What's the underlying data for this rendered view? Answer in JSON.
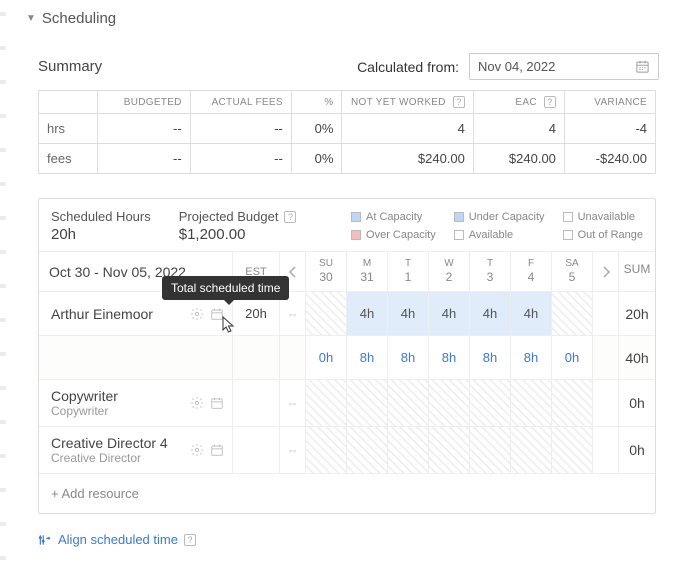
{
  "section_title": "Scheduling",
  "summary_label": "Summary",
  "calc_from_label": "Calculated from:",
  "calc_date": "Nov 04, 2022",
  "tooltip": "Total scheduled time",
  "summary_table": {
    "cols": [
      "BUDGETED",
      "ACTUAL FEES",
      "%",
      "NOT YET WORKED",
      "EAC",
      "VARIANCE"
    ],
    "rows": [
      {
        "label": "hrs",
        "cells": [
          "--",
          "--",
          "0%",
          "4",
          "4",
          "-4"
        ]
      },
      {
        "label": "fees",
        "cells": [
          "--",
          "--",
          "0%",
          "$240.00",
          "$240.00",
          "-$240.00"
        ]
      }
    ]
  },
  "metrics": {
    "sched_hours_label": "Scheduled Hours",
    "sched_hours_val": "20h",
    "proj_budget_label": "Projected Budget",
    "proj_budget_val": "$1,200.00"
  },
  "legend": {
    "atcap": "At Capacity",
    "under": "Under Capacity",
    "unavail": "Unavailable",
    "over": "Over Capacity",
    "avail": "Available",
    "outrange": "Out of Range"
  },
  "colors": {
    "atcap": "#bdd6f5",
    "under": "#bdd6f5",
    "over": "#f5bdbf",
    "avail": "#ffffff",
    "unavail": "#ffffff",
    "outrange": "#ffffff"
  },
  "range": {
    "label": "Oct 30 - Nov 05, 2022",
    "est": "EST",
    "days": [
      {
        "d": "SU",
        "n": "30"
      },
      {
        "d": "M",
        "n": "31"
      },
      {
        "d": "T",
        "n": "1"
      },
      {
        "d": "W",
        "n": "2"
      },
      {
        "d": "T",
        "n": "3"
      },
      {
        "d": "F",
        "n": "4"
      },
      {
        "d": "SA",
        "n": "5"
      }
    ],
    "sum": "SUM"
  },
  "resources": [
    {
      "name": "Arthur Einemoor",
      "role": "",
      "est": "20h",
      "cells": [
        "",
        "4h",
        "4h",
        "4h",
        "4h",
        "4h",
        ""
      ],
      "sum": "20h",
      "style": [
        "hatch",
        "blue",
        "blue",
        "blue",
        "blue",
        "blue",
        "hatch"
      ]
    },
    {
      "name": "",
      "role": "",
      "est": "",
      "cells": [
        "0h",
        "8h",
        "8h",
        "8h",
        "8h",
        "8h",
        "0h"
      ],
      "sum": "40h",
      "style": [
        "avail",
        "avail",
        "avail",
        "avail",
        "avail",
        "avail",
        "avail"
      ],
      "totals": true
    },
    {
      "name": "Copywriter",
      "role": "Copywriter",
      "est": "",
      "cells": [
        "",
        "",
        "",
        "",
        "",
        "",
        ""
      ],
      "sum": "0h",
      "style": [
        "hatch",
        "hatch",
        "hatch",
        "hatch",
        "hatch",
        "hatch",
        "hatch"
      ]
    },
    {
      "name": "Creative Director 4",
      "role": "Creative Director",
      "est": "",
      "cells": [
        "",
        "",
        "",
        "",
        "",
        "",
        ""
      ],
      "sum": "0h",
      "style": [
        "hatch",
        "hatch",
        "hatch",
        "hatch",
        "hatch",
        "hatch",
        "hatch"
      ]
    }
  ],
  "add_resource": "+ Add resource",
  "align_link": "Align scheduled time"
}
